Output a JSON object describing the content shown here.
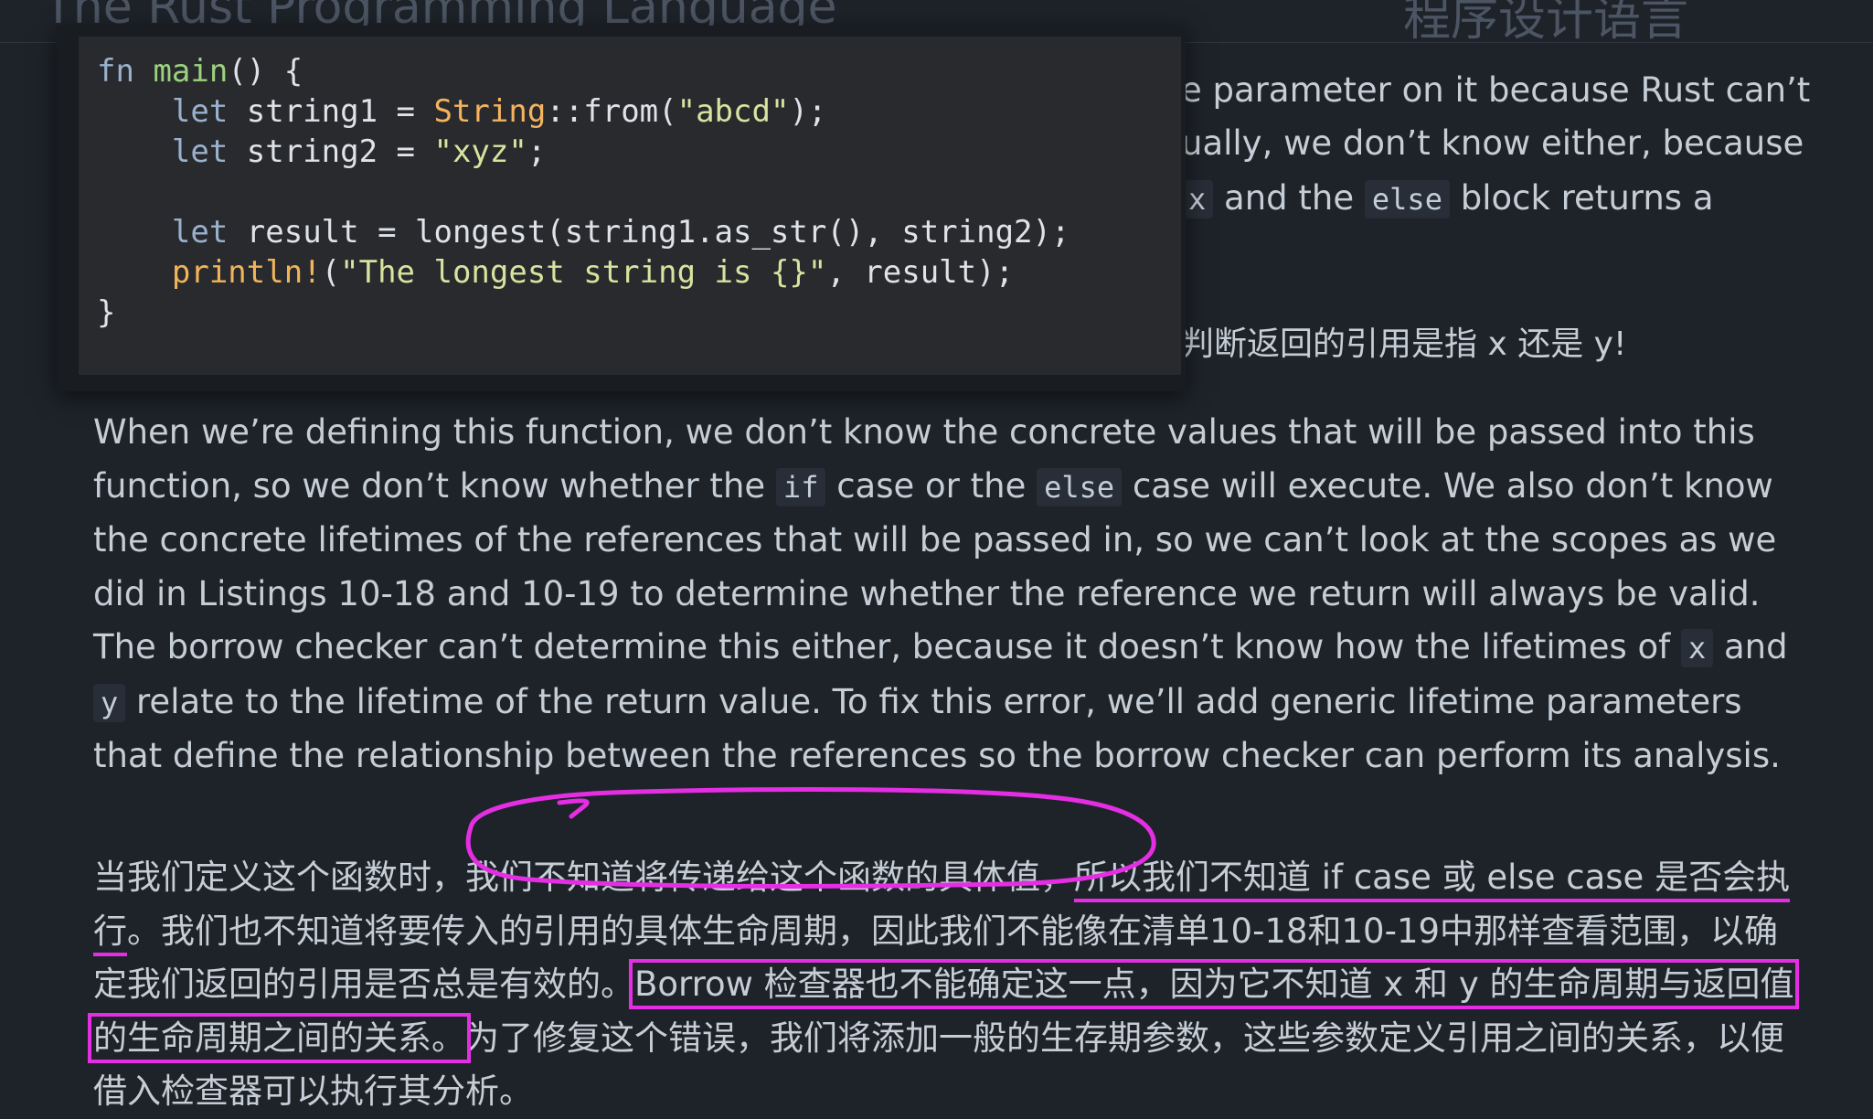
{
  "header": {
    "title": "The Rust Programming Language",
    "title_cn": "程序设计语言"
  },
  "popover_code": {
    "lines": [
      [
        "fn",
        " ",
        "main",
        "() {"
      ],
      [
        "    ",
        "let",
        " string1 = ",
        "String",
        "::from(",
        "\"abcd\"",
        ");"
      ],
      [
        "    ",
        "let",
        " string2 = ",
        "\"xyz\"",
        ";"
      ],
      [
        ""
      ],
      [
        "    ",
        "let",
        " result = longest(string1.as_str(), string2);"
      ],
      [
        "    ",
        "println!",
        "(",
        "\"The longest string is {}\"",
        ", result);"
      ],
      [
        "}"
      ]
    ]
  },
  "partial_lines": {
    "l1": "e parameter on it because Rust can’t",
    "l2": "ually, we don’t know either, because",
    "l3_code_x": "x",
    "l3_mid": " and the ",
    "l3_code_else": "else",
    "l3_end": " block returns a",
    "l4_cn": "判断返回的引用是指 x 还是 y!"
  },
  "para_en": {
    "t1": "When we’re defining this function, we don’t know the concrete values that will be passed into this function, so we don’t know whether the ",
    "c_if": "if",
    "t2": " case or the ",
    "c_else": "else",
    "t3": " case will execute. We also don’t know the concrete lifetimes of the references that will be passed in, so we can’t look at the scopes as we did in Listings 10-18 and 10-19 to determine whether the reference we return will always be valid. The borrow checker can’t determine this either, because it doesn’t know how the lifetimes of ",
    "c_x": "x",
    "t4": " and ",
    "c_y": "y",
    "t5": " relate to the lifetime of the return value. To fix this error, we’ll add generic lifetime parameters that define the relationship between the references so the borrow checker can perform its analysis."
  },
  "para_cn": {
    "s1": "当我们定义这个函数时，",
    "s2": "我们不知道将传递给这个函数的具体值，",
    "s3": "所以我们不知道 if case 或 else case 是否会执行",
    "s4": "。我们也不知道将要传入的引用的具体生命周期，因此我们不能像在清单10-18和10-19中那样查看范围，以确定我们返回的引用是否总是有效的。",
    "s5": "Borrow 检查器也不能确定这一点，因为它不知道 x 和 y 的生命周期与返回值的生命周期之间的关系。",
    "s6": "为了修复这个错误，我们将添加一般的生存期参数，这些参数定义引用之间的关系，以便借入检查器可以执行其分析。"
  },
  "annotation": {
    "color": "#e52ee4",
    "shapes": [
      "ellipse-around-s2",
      "underline-s3",
      "box-around-s5"
    ]
  }
}
